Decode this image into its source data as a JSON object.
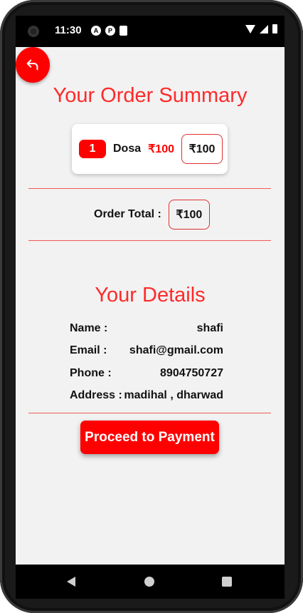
{
  "status_bar": {
    "time": "11:30",
    "icons": [
      "A",
      "P",
      "▮"
    ]
  },
  "order": {
    "title": "Your Order Summary",
    "items": [
      {
        "quantity": "1",
        "name": "Dosa",
        "price": "₹100",
        "total": "₹100"
      }
    ],
    "total_label": "Order Total :",
    "total_value": "₹100"
  },
  "details": {
    "title": "Your Details",
    "rows": [
      {
        "label": "Name :",
        "value": "shafi"
      },
      {
        "label": "Email :",
        "value": "shafi@gmail.com"
      },
      {
        "label": "Phone :",
        "value": "8904750727"
      },
      {
        "label": "Address :",
        "value": "madihal , dharwad"
      }
    ]
  },
  "actions": {
    "proceed_label": "Proceed to Payment"
  },
  "colors": {
    "accent": "#ff0000",
    "title": "#ff2a2a",
    "background": "#f2f2f2"
  }
}
